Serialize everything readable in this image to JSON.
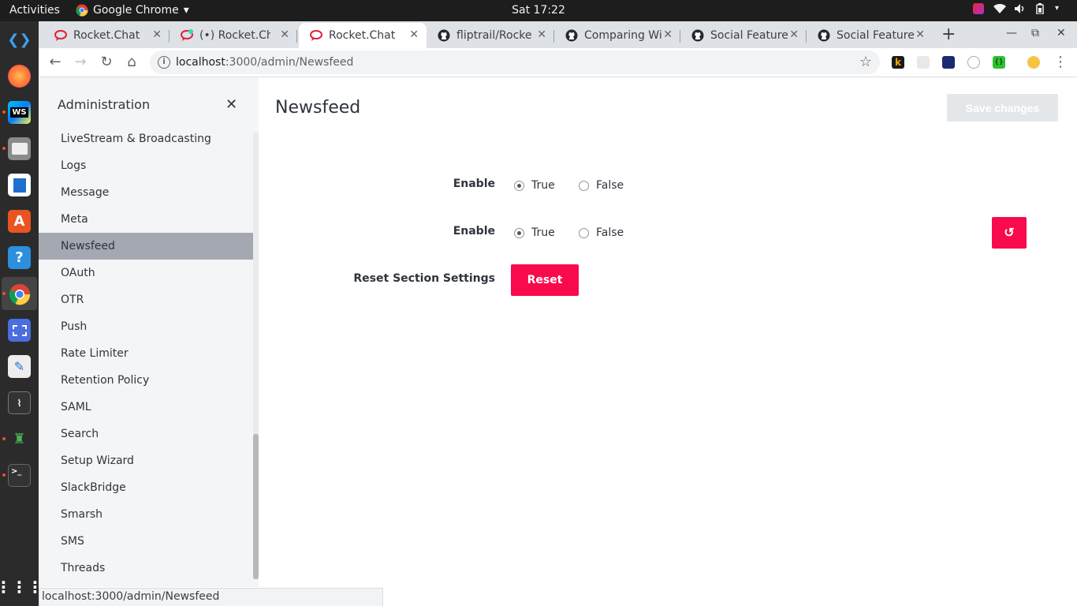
{
  "os": {
    "activities": "Activities",
    "app_name": "Google Chrome",
    "clock": "Sat 17:22"
  },
  "browser": {
    "tabs": [
      {
        "label": "Rocket.Chat D",
        "favicon": "rocketchat-icon",
        "active": false
      },
      {
        "label": "(•) Rocket.Cha",
        "favicon": "rocketchat-icon",
        "active": false
      },
      {
        "label": "Rocket.Chat",
        "favicon": "rocketchat-icon",
        "active": true
      },
      {
        "label": "fliptrail/Rocke",
        "favicon": "github-icon",
        "active": false
      },
      {
        "label": "Comparing Wi",
        "favicon": "github-icon",
        "active": false
      },
      {
        "label": "Social Feature",
        "favicon": "github-icon",
        "active": false
      },
      {
        "label": "Social Feature",
        "favicon": "github-icon",
        "active": false
      }
    ],
    "url_host": "localhost",
    "url_path": ":3000/admin/Newsfeed",
    "status_url": "localhost:3000/admin/Newsfeed"
  },
  "sidebar": {
    "title": "Administration",
    "items": [
      "LiveStream & Broadcasting",
      "Logs",
      "Message",
      "Meta",
      "Newsfeed",
      "OAuth",
      "OTR",
      "Push",
      "Rate Limiter",
      "Retention Policy",
      "SAML",
      "Search",
      "Setup Wizard",
      "SlackBridge",
      "Smarsh",
      "SMS",
      "Threads"
    ],
    "selected": "Newsfeed"
  },
  "main": {
    "title": "Newsfeed",
    "save_label": "Save changes",
    "settings": [
      {
        "label": "Enable",
        "true_label": "True",
        "false_label": "False",
        "value": true
      },
      {
        "label": "Enable",
        "true_label": "True",
        "false_label": "False",
        "value": true
      }
    ],
    "reset_section_label": "Reset Section Settings",
    "reset_label": "Reset"
  },
  "colors": {
    "accent": "#f90a4d",
    "sidebar_bg": "#f4f5f7",
    "selected_bg": "#a4a8b0"
  }
}
